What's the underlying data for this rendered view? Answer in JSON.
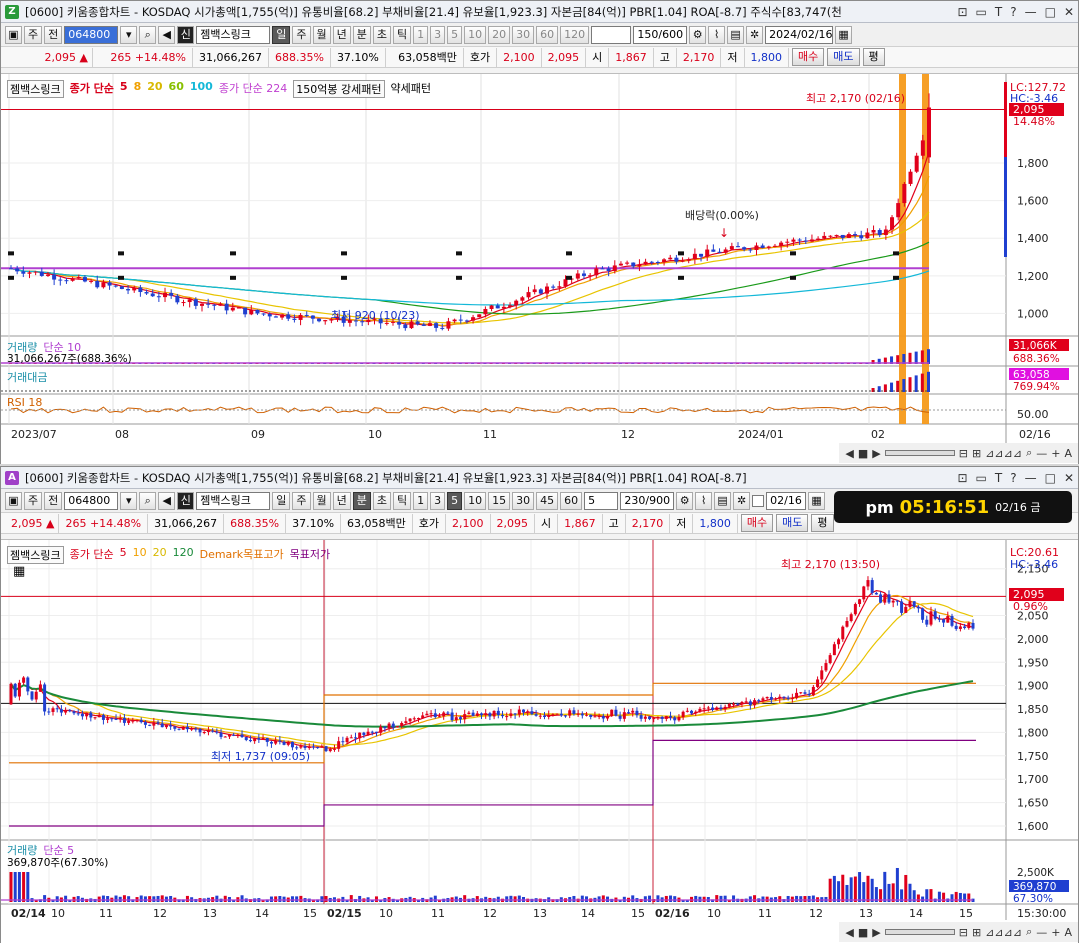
{
  "top": {
    "icon": "Z",
    "title": "[0600] 키움종합차트 - KOSDAQ 시가총액[1,755(억)] 유통비율[68.2] 부채비율[21.4] 유보율[1,923.3] 자본금[84(억)] PBR[1.04] ROA[-8.7] 주식수[83,747(천",
    "window_buttons": [
      "⊡",
      "▭",
      "T",
      "?",
      "—",
      "□",
      "✕"
    ],
    "tb": {
      "mode1": "주",
      "mode2": "전",
      "code": "064800",
      "name": "젬백스링크",
      "periods": [
        "일",
        "주",
        "월",
        "년",
        "분",
        "초",
        "틱"
      ],
      "active_period": "일",
      "nums": [
        "1",
        "3",
        "5",
        "10",
        "20",
        "30",
        "60",
        "120"
      ],
      "count": "150/600",
      "date": "2024/02/16"
    },
    "quote": {
      "price": "2,095",
      "arrow": "▲",
      "change": "265",
      "pct": "+14.48%",
      "volume": "31,066,267",
      "vol_ratio": "688.35%",
      "turnover": "37.10%",
      "amount": "63,058백만",
      "hoga_label": "호가",
      "ask": "2,100",
      "bid": "2,095",
      "open_label": "시",
      "open": "1,867",
      "high_label": "고",
      "high": "2,170",
      "low_label": "저",
      "low": "1,800",
      "buy": "매수",
      "sell": "매도",
      "eval": "평"
    },
    "legend": {
      "name": "젬백스링크",
      "ma_label": "종가 단순",
      "ma5": "5",
      "ma8": "8",
      "ma20": "20",
      "ma60": "60",
      "ma100": "100",
      "ma224": "종가 단순 224",
      "p1": "150억봉 강세패턴",
      "p2": "약세패턴"
    },
    "annotations": {
      "high": "최고 2,170 (02/16)",
      "low": "최저 920 (10/23)",
      "div": "배당락(0.00%)"
    },
    "axis": {
      "lc": "LC:127.72",
      "hc": "HC:-3.46",
      "price": "2,095",
      "pct": "14.48%",
      "ticks": [
        "1,800",
        "1,600",
        "1,400",
        "1,200",
        "1,000"
      ]
    },
    "vol": {
      "label": "거래량",
      "ma": "단순 10",
      "value": "31,066,267주(688.36%)",
      "tag": "31,066K",
      "pct": "688.36%"
    },
    "amt": {
      "label": "거래대금",
      "tag": "63,058",
      "pct": "769.94%"
    },
    "rsi": {
      "label": "RSI 18",
      "tick": "50.00"
    },
    "dates": [
      "2023/07",
      "08",
      "09",
      "10",
      "11",
      "12",
      "2024/01",
      "02"
    ],
    "last_date": "02/16"
  },
  "bottom": {
    "icon": "A",
    "title": "[0600] 키움종합차트 - KOSDAQ 시가총액[1,755(억)] 유통비율[68.2] 부채비율[21.4] 유보율[1,923.3] 자본금[84(억)] PBR[1.04] ROA[-8.7]",
    "tb": {
      "mode1": "주",
      "mode2": "전",
      "code": "064800",
      "name": "젬백스링크",
      "periods": [
        "일",
        "주",
        "월",
        "년",
        "분",
        "초",
        "틱"
      ],
      "active_period": "분",
      "nums": [
        "1",
        "3",
        "5",
        "10",
        "15",
        "30",
        "45",
        "60"
      ],
      "interval": "5",
      "count": "230/900",
      "date": "02/16"
    },
    "clock": {
      "ampm": "pm",
      "time": "05:16:51",
      "date": "02/16 금"
    },
    "legend": {
      "name": "젬백스링크",
      "ma_label": "종가 단순",
      "ma5": "5",
      "ma10": "10",
      "ma20": "20",
      "ma120": "120",
      "demark_hi": "Demark목표고가",
      "demark_lo": "목표저가"
    },
    "annotations": {
      "high": "최고 2,170 (13:50)",
      "low": "최저 1,737 (09:05)"
    },
    "axis": {
      "lc": "LC:20.61",
      "hc": "HC:-3.46",
      "price": "2,095",
      "pct": "0.96%",
      "ticks": [
        "2,150",
        "2,050",
        "2,000",
        "1,950",
        "1,900",
        "1,850",
        "1,800",
        "1,750",
        "1,700",
        "1,650",
        "1,600"
      ]
    },
    "vol": {
      "label": "거래량",
      "ma": "단순 5",
      "value": "369,870주(67.30%)",
      "tick": "2,500K",
      "tag": "369,870",
      "pct": "67.30%"
    },
    "dates": [
      "02/14",
      "10",
      "11",
      "12",
      "13",
      "14",
      "15",
      "02/15",
      "10",
      "11",
      "12",
      "13",
      "14",
      "15",
      "02/16",
      "10",
      "11",
      "12",
      "13",
      "14",
      "15"
    ],
    "last_time": "15:30:00"
  },
  "colors": {
    "up": "#e0001b",
    "down": "#1f3fd0",
    "ma5": "#e0001b",
    "ma8": "#f0a000",
    "ma20": "#e8c400",
    "ma60": "#1a9a1a",
    "ma100": "#14b8d8",
    "ma224": "#b040d0",
    "highlight": "#f59a1a"
  }
}
